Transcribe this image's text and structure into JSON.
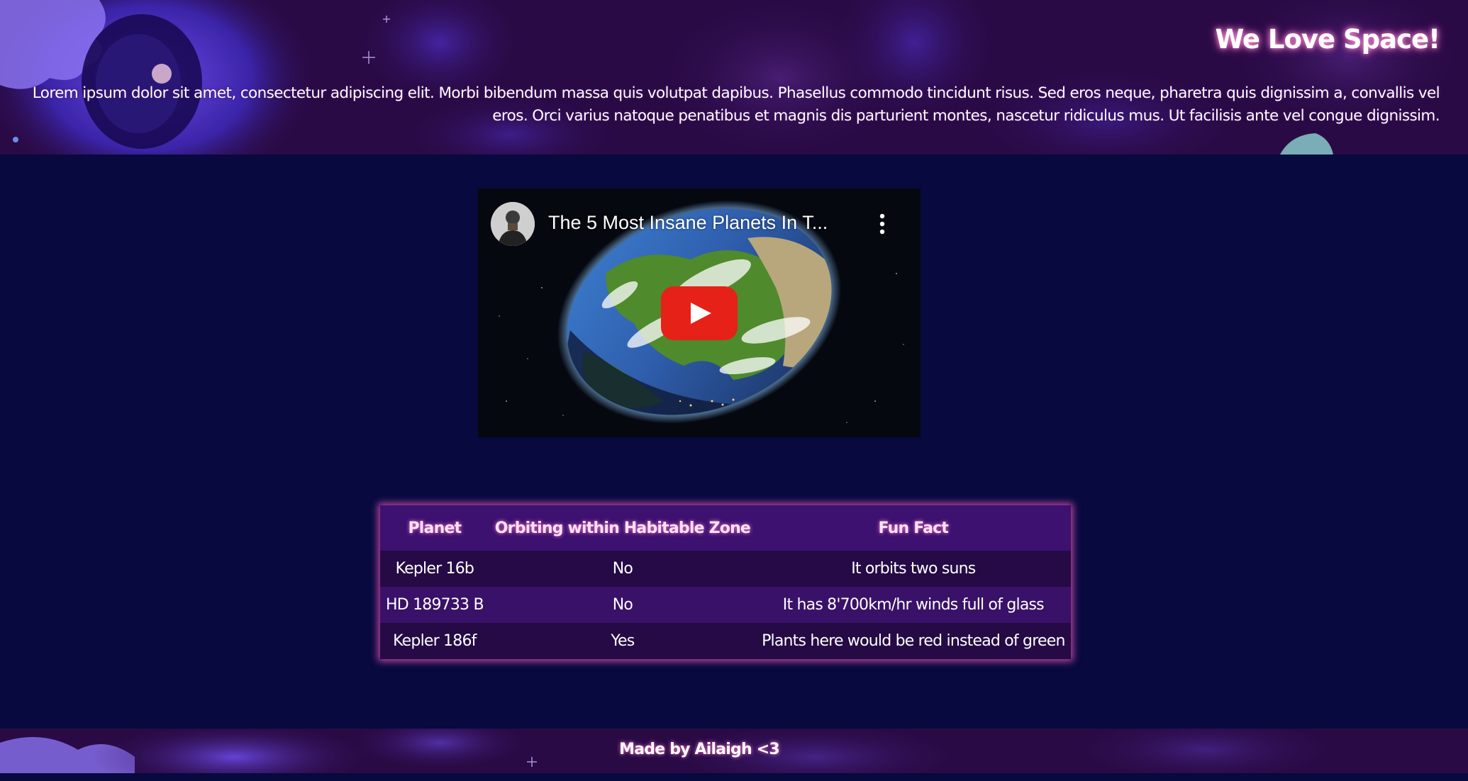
{
  "header": {
    "title": "We Love Space!",
    "intro": "Lorem ipsum dolor sit amet, consectetur adipiscing elit. Morbi bibendum massa quis volutpat dapibus. Phasellus commodo tincidunt risus. Sed eros neque, pharetra quis dignissim a, convallis vel eros. Orci varius natoque penatibus et magnis dis parturient montes, nascetur ridiculus mus. Ut facilisis ante vel congue dignissim."
  },
  "video": {
    "title": "The 5 Most Insane Planets In T...",
    "play_icon": "youtube-play-icon",
    "menu_icon": "more-vert-icon",
    "play_color": "#e62117"
  },
  "table": {
    "headers": [
      "Planet",
      "Orbiting within Habitable Zone",
      "Fun Fact"
    ],
    "rows": [
      [
        "Kepler 16b",
        "No",
        "It orbits two suns"
      ],
      [
        "HD 189733 B",
        "No",
        "It has 8'700km/hr winds full of glass"
      ],
      [
        "Kepler 186f",
        "Yes",
        "Plants here would be red instead of green"
      ]
    ]
  },
  "footer": {
    "text": "Made by Ailaigh <3"
  },
  "colors": {
    "page_background": "#07093f",
    "header_background": "#2a0a45",
    "table_header": "#3c1170",
    "table_row_dark": "#250a45",
    "table_row_light": "#3a1168",
    "glow": "#c2479f"
  }
}
